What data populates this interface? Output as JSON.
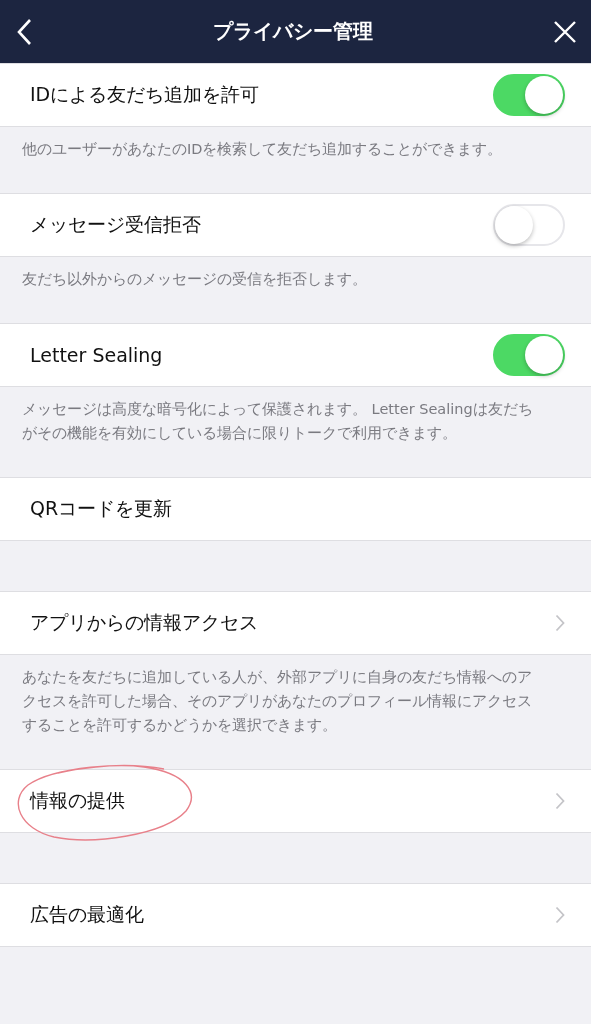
{
  "header": {
    "title": "プライバシー管理"
  },
  "sections": [
    {
      "kind": "toggle",
      "label": "IDによる友だち追加を許可",
      "on": true,
      "description": "他のユーザーがあなたのIDを検索して友だち追加することができます。",
      "circled": false
    },
    {
      "kind": "toggle",
      "label": "メッセージ受信拒否",
      "on": false,
      "description": "友だち以外からのメッセージの受信を拒否します。",
      "circled": false
    },
    {
      "kind": "toggle",
      "label": "Letter Sealing",
      "on": true,
      "description": "メッセージは高度な暗号化によって保護されます。 Letter Sealingは友だちがその機能を有効にしている場合に限りトークで利用できます。",
      "circled": false
    },
    {
      "kind": "plain",
      "label": "QRコードを更新",
      "circled": false
    },
    {
      "kind": "link",
      "label": "アプリからの情報アクセス",
      "description": "あなたを友だちに追加している人が、外部アプリに自身の友だち情報へのアクセスを許可した場合、そのアプリがあなたのプロフィール情報にアクセスすることを許可するかどうかを選択できます。",
      "circled": false
    },
    {
      "kind": "link",
      "label": "情報の提供",
      "circled": true
    },
    {
      "kind": "link",
      "label": "広告の最適化",
      "circled": false
    }
  ]
}
